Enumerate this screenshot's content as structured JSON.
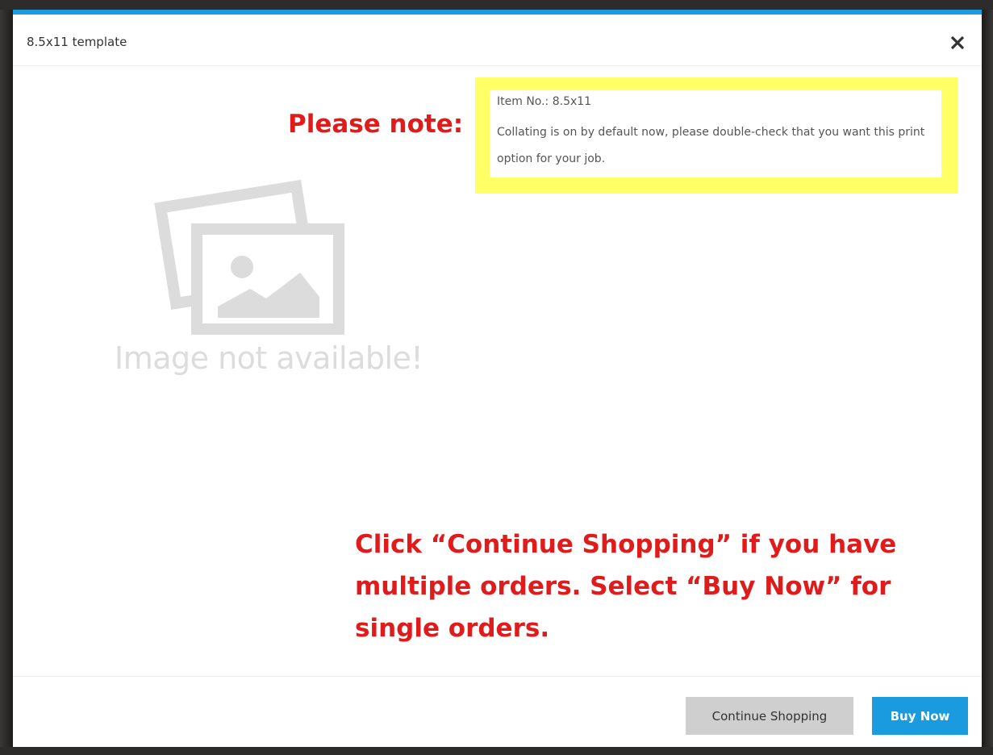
{
  "modal": {
    "title": "8.5x11 template",
    "close_icon": "close-icon",
    "accent_color": "#1a9be0"
  },
  "placeholder": {
    "icon": "image-placeholder-icon",
    "text": "Image not available!"
  },
  "annotations": {
    "please_note": "Please note:",
    "instruction": "Click “Continue Shopping” if you have multiple orders. Select “Buy Now” for single orders.",
    "annotation_color": "#e01b1b",
    "highlight_color": "#ffff66"
  },
  "item": {
    "item_no": "Item No.: 8.5x11",
    "note": "Collating is on by default now, please double-check that you want this print option for your job."
  },
  "footer": {
    "continue_label": "Continue Shopping",
    "buy_label": "Buy Now"
  }
}
